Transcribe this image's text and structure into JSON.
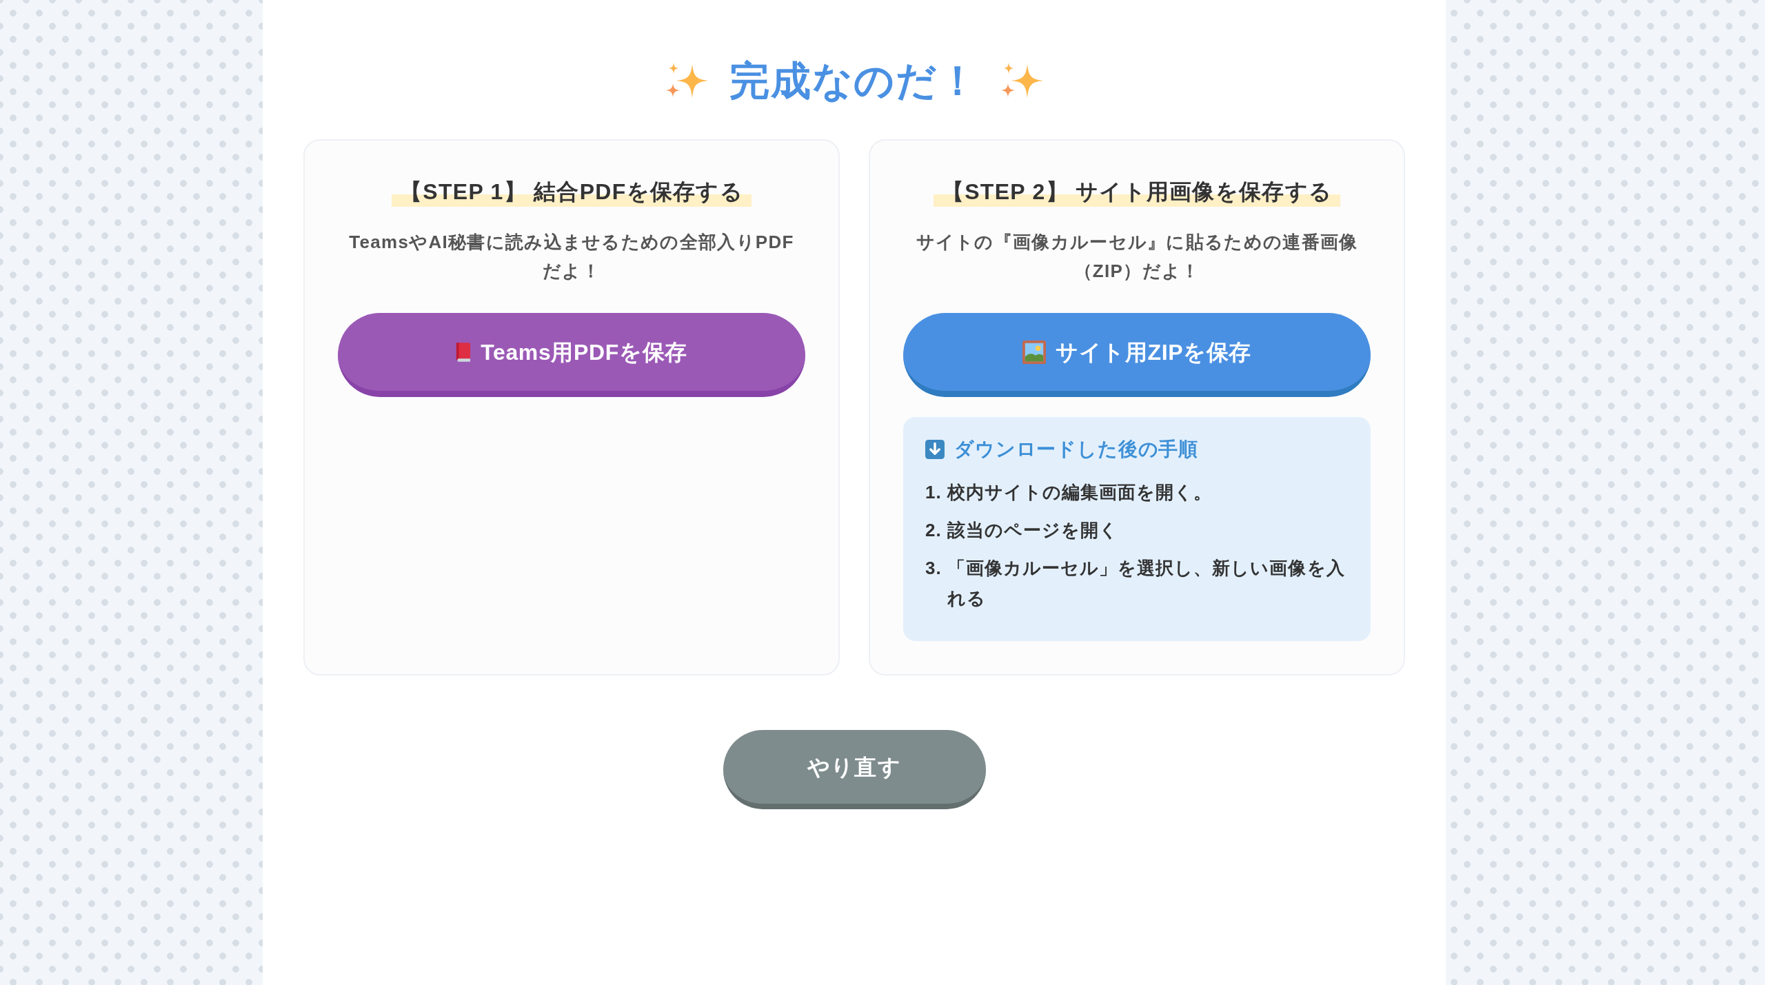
{
  "title": "完成なのだ！",
  "steps": [
    {
      "heading": "【STEP 1】 結合PDFを保存する",
      "description": "TeamsやAI秘書に読み込ませるための全部入りPDFだよ！",
      "button": {
        "label": "Teams用PDFを保存",
        "kind": "pdf"
      }
    },
    {
      "heading": "【STEP 2】 サイト用画像を保存する",
      "description": "サイトの『画像カルーセル』に貼るための連番画像（ZIP）だよ！",
      "button": {
        "label": "サイト用ZIPを保存",
        "kind": "zip"
      },
      "instructions": {
        "heading": "ダウンロードした後の手順",
        "items": [
          {
            "number": "1.",
            "text": "校内サイトの編集画面を開く。"
          },
          {
            "number": "2.",
            "text": "該当のページを開く"
          },
          {
            "number": "3.",
            "text": "「画像カルーセル」を選択し、新しい画像を入れる"
          }
        ]
      }
    }
  ],
  "retry_button": {
    "label": "やり直す"
  }
}
